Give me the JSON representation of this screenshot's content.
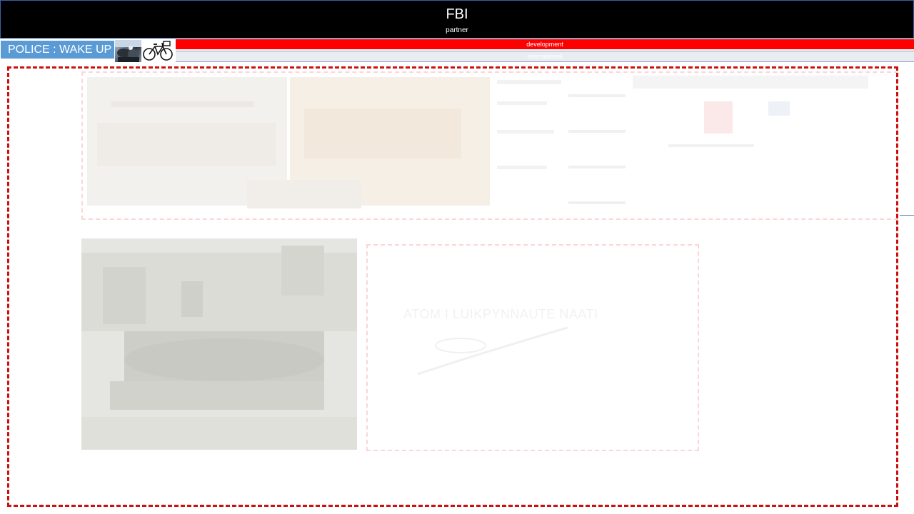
{
  "header": {
    "title": "FBI",
    "subtitle": "partner"
  },
  "badge": {
    "label": "POLICE : WAKE UP"
  },
  "red_bar": {
    "label": "development"
  },
  "gray_bar": {
    "label": "International"
  },
  "card": {
    "title": "ATOM I LUIKPYNNAUTE NAATI"
  },
  "colors": {
    "header_bg": "#000000",
    "badge_bg": "#5b9bd5",
    "red_bar_bg": "#ff0000",
    "dashed_border": "#cc1111"
  },
  "icons": {
    "thumb_photo": "photo-thumbnail-icon",
    "bike": "bicycle-icon"
  }
}
